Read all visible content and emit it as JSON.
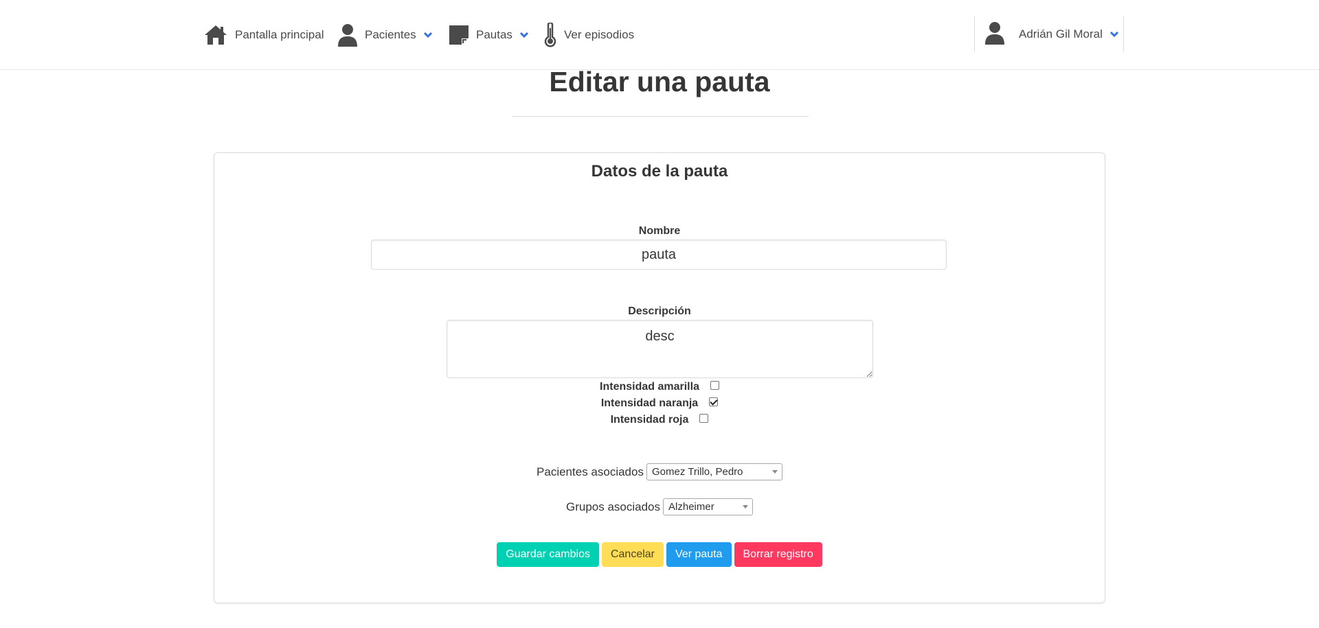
{
  "navbar": {
    "home_label": "Pantalla principal",
    "pacientes_label": "Pacientes",
    "pautas_label": "Pautas",
    "episodios_label": "Ver episodios",
    "user_label": "Adrián Gil Moral",
    "icons": [
      "home-icon",
      "user-icon",
      "note-icon",
      "thermometer-icon",
      "chevron-down-icon"
    ],
    "accent_color": "#3273dc"
  },
  "page": {
    "title": "Editar una pauta"
  },
  "form": {
    "section_title": "Datos de la pauta",
    "nombre_label": "Nombre",
    "nombre_value": "pauta",
    "descripcion_label": "Descripción",
    "descripcion_value": "desc",
    "checks": [
      {
        "label": "Intensidad amarilla",
        "checked": false
      },
      {
        "label": "Intensidad naranja",
        "checked": true
      },
      {
        "label": "Intensidad roja",
        "checked": false
      }
    ],
    "pacientes_label": "Pacientes asociados",
    "pacientes_selected": "Gomez Trillo, Pedro",
    "grupos_label": "Grupos asociados",
    "grupos_selected": "Alzheimer"
  },
  "buttons": {
    "guardar": "Guardar cambios",
    "cancelar": "Cancelar",
    "ver": "Ver pauta",
    "borrar": "Borrar registro",
    "colors": {
      "guardar": "#00d1b2",
      "cancelar": "#ffdd57",
      "ver": "#209cee",
      "borrar": "#ff3860"
    }
  }
}
